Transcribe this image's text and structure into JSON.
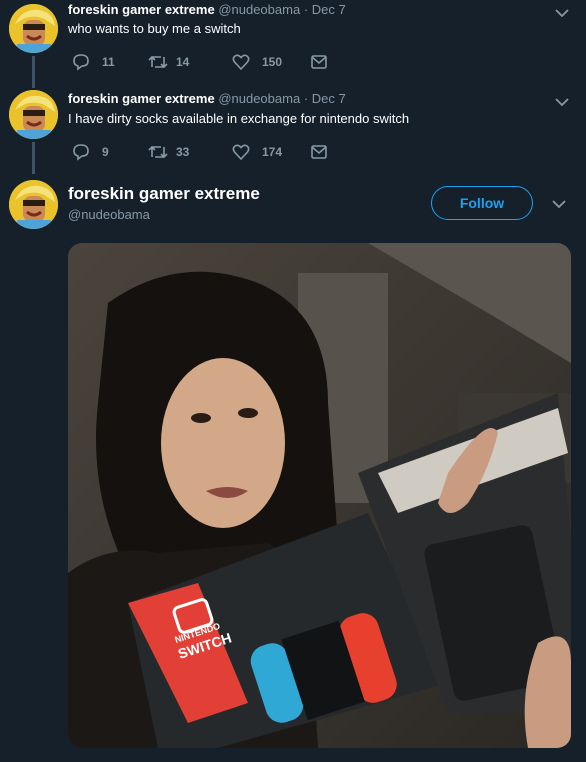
{
  "tweets": [
    {
      "name": "foreskin gamer extreme",
      "handle": "@nudeobama",
      "date": "· Dec 7",
      "text": "who wants to buy me a switch",
      "replies": "11",
      "retweets": "14",
      "likes": "150"
    },
    {
      "name": "foreskin gamer extreme",
      "handle": "@nudeobama",
      "date": "· Dec 7",
      "text": "I have dirty socks available in exchange for nintendo switch",
      "replies": "9",
      "retweets": "33",
      "likes": "174"
    }
  ],
  "main_tweet": {
    "name": "foreskin gamer extreme",
    "handle": "@nudeobama",
    "follow_label": "Follow",
    "box_brand": "NINTENDO",
    "box_model": "SWITCH"
  },
  "colors": {
    "background": "#15202b",
    "accent": "#1da1f2",
    "secondary_text": "#8899a6",
    "thread_line": "#3d5466",
    "joycon_red": "#e8402e",
    "joycon_blue": "#2fa8d6"
  }
}
